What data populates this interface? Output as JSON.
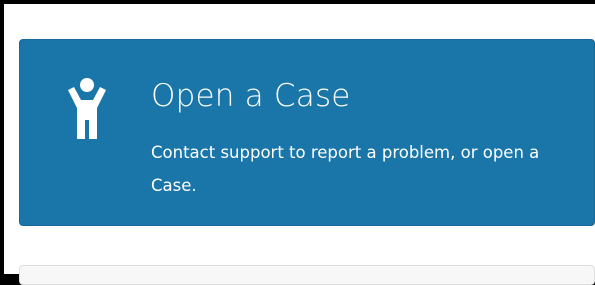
{
  "colors": {
    "card_background": "#1a76a8",
    "card_text": "#ffffff",
    "page_background": "#ffffff",
    "outer_border": "#000000"
  },
  "case_card": {
    "icon": "person-arms-up-icon",
    "title": "Open a Case",
    "description": "Contact support to report a problem, or open a Case."
  }
}
